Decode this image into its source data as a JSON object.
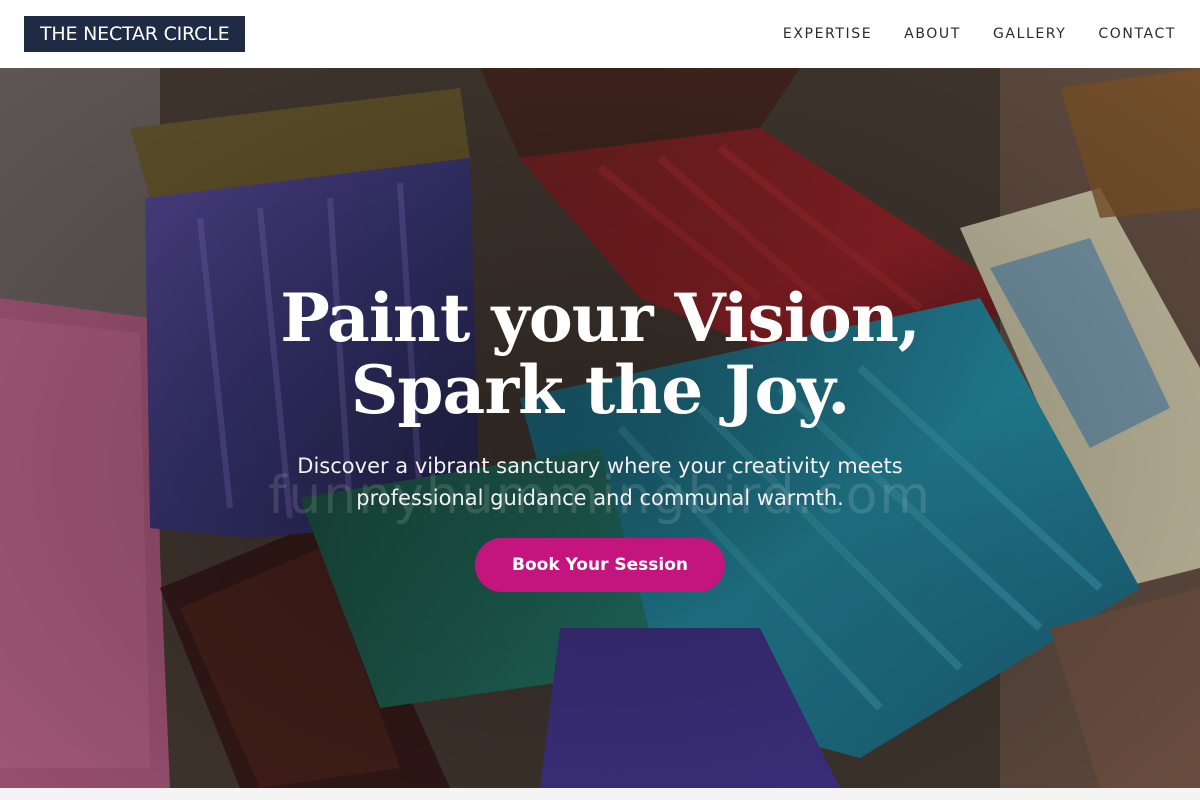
{
  "header": {
    "logo": "THE NECTAR CIRCLE",
    "nav": [
      {
        "label": "EXPERTISE"
      },
      {
        "label": "ABOUT"
      },
      {
        "label": "GALLERY"
      },
      {
        "label": "CONTACT"
      }
    ]
  },
  "hero": {
    "headline_line1": "Paint your Vision,",
    "headline_line2": "Spark the Joy.",
    "subhead_line1": "Discover a vibrant sanctuary where your creativity meets",
    "subhead_line2": "professional guidance and communal warmth.",
    "cta_label": "Book Your Session",
    "watermark": "funnyhummingbird.com",
    "background_image": "paint-brushes-photo"
  },
  "colors": {
    "logo_bg": "#1f2a44",
    "cta_bg": "#c4157f",
    "nav_text": "#2b2b2b"
  }
}
